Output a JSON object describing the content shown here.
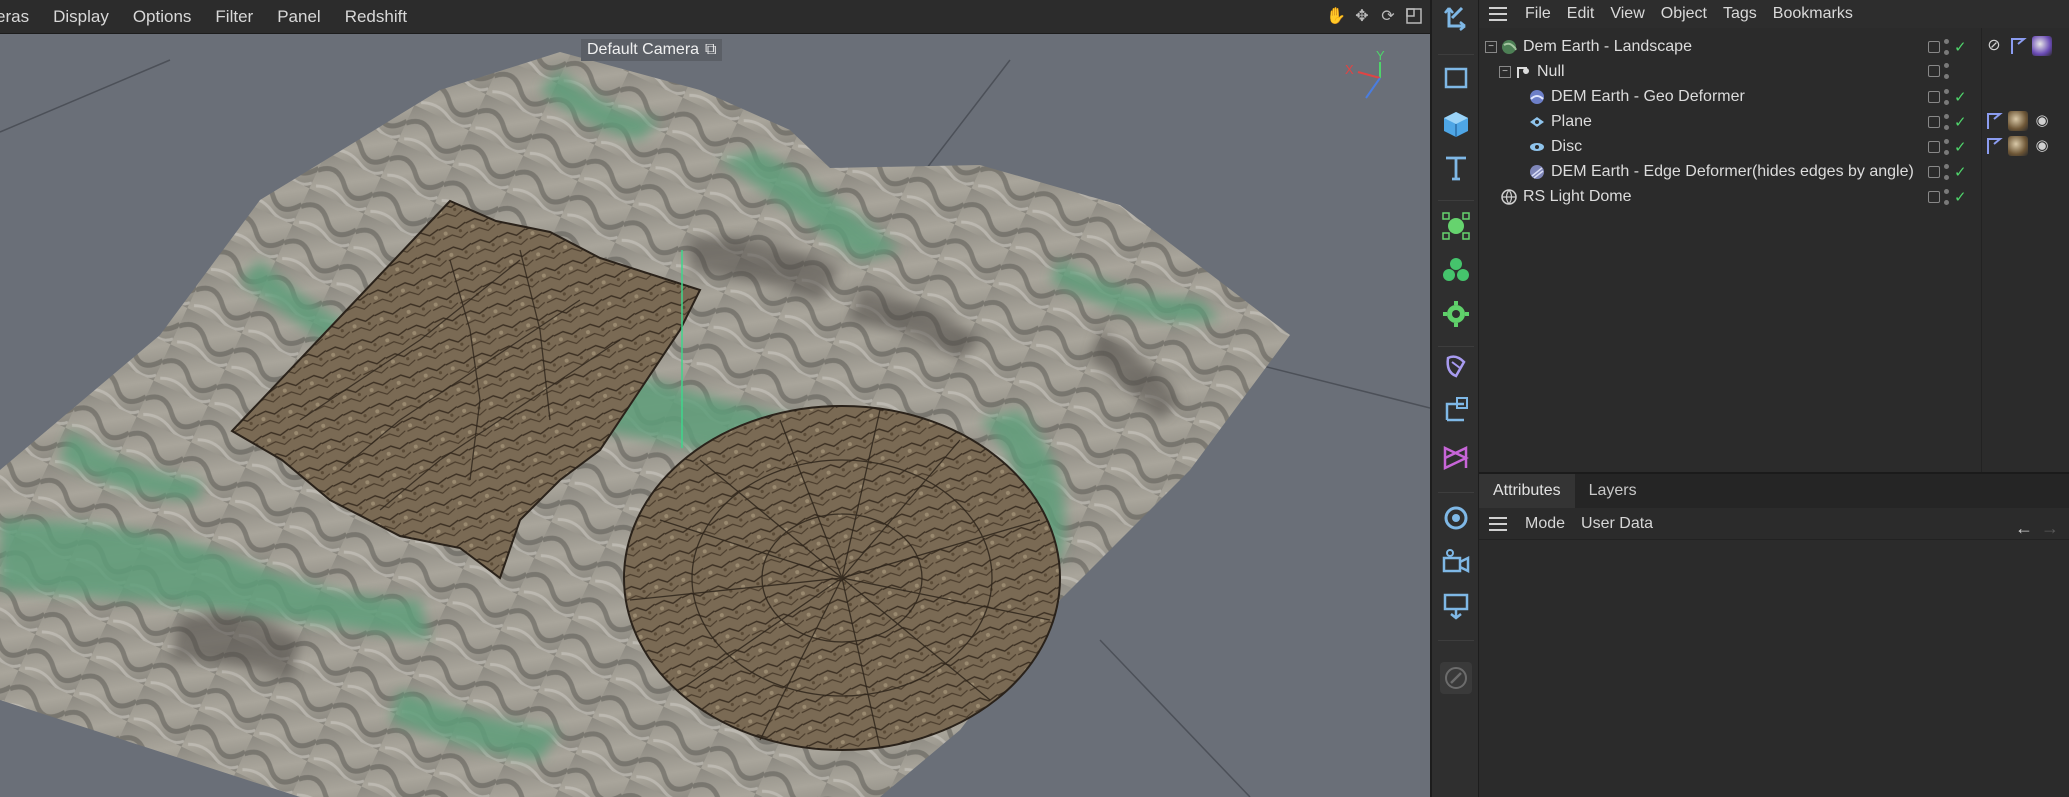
{
  "viewport": {
    "menu": [
      "eras",
      "Display",
      "Options",
      "Filter",
      "Panel",
      "Redshift"
    ],
    "camera_label": "Default Camera",
    "tools": [
      "hand-icon",
      "move-icon",
      "rotate-icon",
      "maximize-icon"
    ],
    "axis": {
      "x": "X",
      "y": "Y"
    }
  },
  "toolstrip": {
    "tools": [
      "select-arrow-icon",
      "rectangle-icon",
      "cube-icon",
      "text-tool-icon",
      "spline-pen-icon",
      "generator-icon",
      "deformer-gear-icon",
      "paint-icon",
      "hierarchy-icon",
      "mograph-icon",
      "light-icon",
      "camera-icon",
      "render-icon",
      "edit-disabled-icon"
    ]
  },
  "object_manager": {
    "menu": [
      "File",
      "Edit",
      "View",
      "Object",
      "Tags",
      "Bookmarks"
    ],
    "items": [
      {
        "name": "Dem Earth - Landscape",
        "icon": "earth-icon",
        "level": 0,
        "expander": "-"
      },
      {
        "name": "Null",
        "icon": "null-icon",
        "level": 1,
        "expander": "-"
      },
      {
        "name": "DEM Earth - Geo Deformer",
        "icon": "geo-deformer-icon",
        "level": 2
      },
      {
        "name": "Plane",
        "icon": "plane-icon",
        "level": 2
      },
      {
        "name": "Disc",
        "icon": "disc-icon",
        "level": 2
      },
      {
        "name": "DEM Earth - Edge Deformer(hides edges by angle)",
        "icon": "edge-deformer-icon",
        "level": 2
      },
      {
        "name": "RS Light Dome",
        "icon": "light-dome-icon",
        "level": 0
      }
    ]
  },
  "attributes": {
    "tabs": [
      "Attributes",
      "Layers"
    ],
    "active_tab": "Attributes",
    "menu": [
      "Mode",
      "User Data"
    ]
  },
  "colors": {
    "check": "#4fd36b",
    "terrain_green": "#5f9e7a",
    "ground_plane": "#6a6f78"
  }
}
